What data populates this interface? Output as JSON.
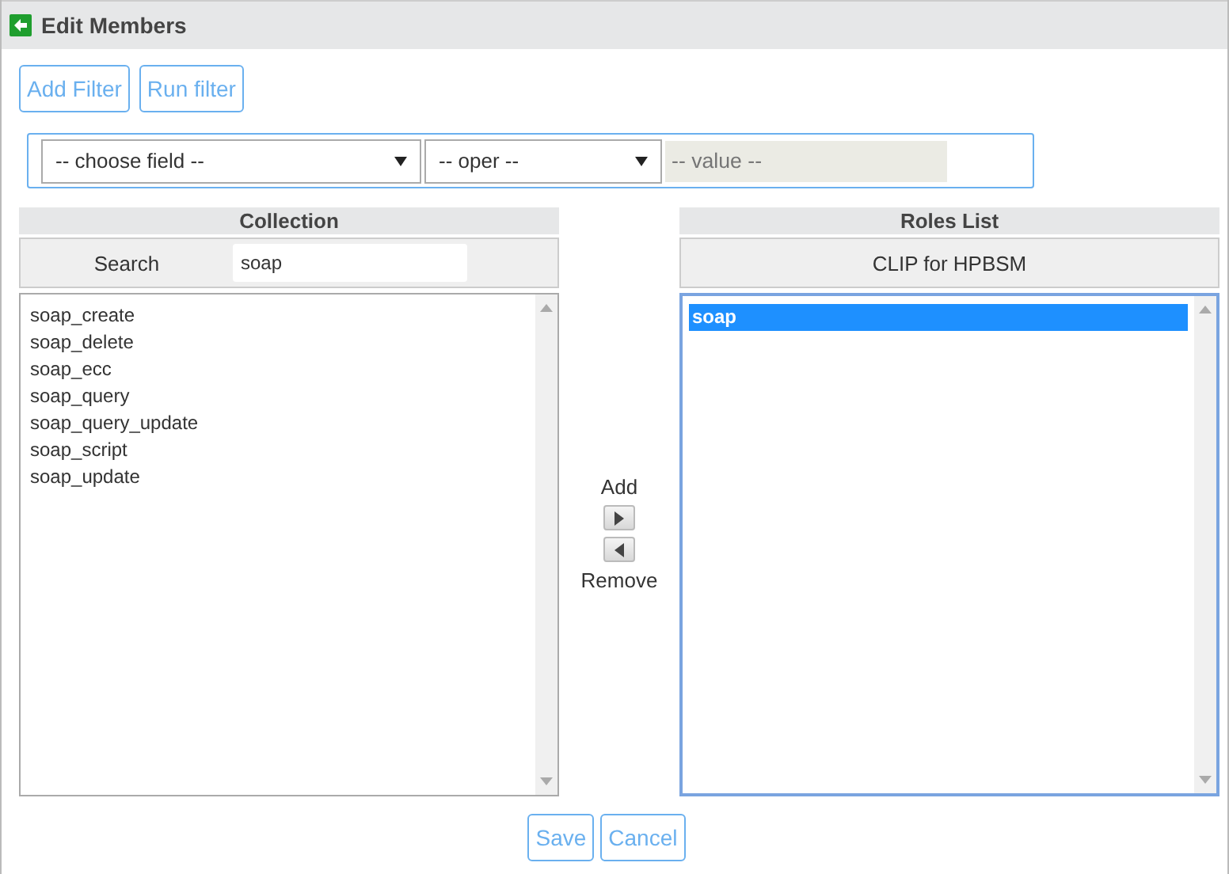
{
  "window": {
    "title": "Edit Members"
  },
  "toolbar": {
    "buttons": [
      "Add Filter",
      "Run filter"
    ]
  },
  "filter": {
    "field": "-- choose field --",
    "operator": "-- oper --",
    "value": {
      "placeholder": "-- value --",
      "disabled": true
    }
  },
  "collection": {
    "title": "Collection",
    "search_label": "Search",
    "search_value": "soap",
    "items": [
      {
        "label": "soap_create",
        "selected": false
      },
      {
        "label": "soap_delete",
        "selected": false
      },
      {
        "label": "soap_ecc",
        "selected": false
      },
      {
        "label": "soap_query",
        "selected": false
      },
      {
        "label": "soap_query_update",
        "selected": false
      },
      {
        "label": "soap_script",
        "selected": false
      },
      {
        "label": "soap_update",
        "selected": false
      }
    ]
  },
  "transfer": {
    "add_label": "Add",
    "remove_label": "Remove"
  },
  "roles": {
    "title": "Roles List",
    "subtitle": "CLIP for HPBSM",
    "focused": true,
    "items": [
      {
        "label": "soap",
        "selected": true
      }
    ]
  },
  "footer": {
    "buttons": [
      "Save",
      "Cancel"
    ]
  }
}
